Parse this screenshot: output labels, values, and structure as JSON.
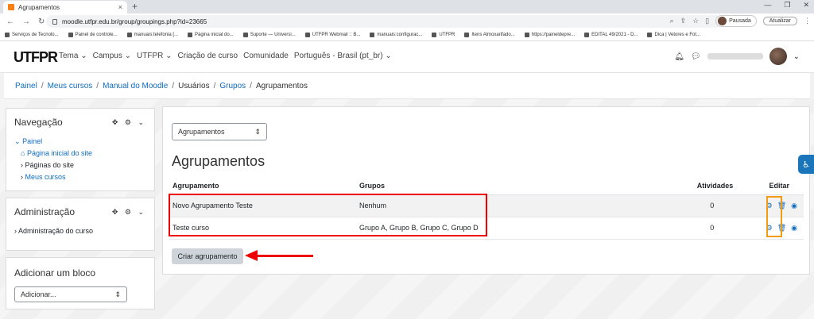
{
  "browser": {
    "tab_title": "Agrupamentos",
    "tab_close": "×",
    "new_tab": "+",
    "url": "moodle.utfpr.edu.br/group/groupings.php?id=23665",
    "profile_label": "Pausada",
    "update_label": "Atualizar",
    "bookmarks": [
      "Serviços de Tecnolo...",
      "Painel de controle...",
      "manuais:telefonia [...",
      "Página inicial do...",
      "Suporte — Universi...",
      "UTFPR Webmail :: B...",
      "manuais:configurac...",
      "UTFPR",
      "Itens Almoxarifado...",
      "https://paineldepre...",
      "EDITAL 49/2021 - D...",
      "Dica | Vetores e Fot..."
    ]
  },
  "moodle_nav": {
    "logo": "UTFPR",
    "menu": [
      "Tema ⌄",
      "Campus ⌄",
      "UTFPR ⌄",
      "Criação de curso",
      "Comunidade",
      "Português - Brasil (pt_br) ⌄"
    ]
  },
  "breadcrumb": [
    "Painel",
    "Meus cursos",
    "Manual do Moodle",
    "Usuários",
    "Grupos",
    "Agrupamentos"
  ],
  "nav_block": {
    "title": "Navegação",
    "items": [
      "Painel",
      "Página inicial do site",
      "Páginas do site",
      "Meus cursos"
    ]
  },
  "admin_block": {
    "title": "Administração",
    "items": [
      "Administração do curso"
    ]
  },
  "add_block": {
    "title": "Adicionar um bloco",
    "select_value": "Adicionar..."
  },
  "main": {
    "dropdown_value": "Agrupamentos",
    "heading": "Agrupamentos",
    "columns": [
      "Agrupamento",
      "Grupos",
      "Atividades",
      "Editar"
    ],
    "rows": [
      {
        "name": "Novo Agrupamento Teste",
        "groups": "Nenhum",
        "activities": "0"
      },
      {
        "name": "Teste curso",
        "groups": "Grupo A, Grupo B, Grupo C, Grupo D",
        "activities": "0"
      }
    ],
    "create_button": "Criar agrupamento"
  },
  "colors": {
    "link": "#0f6cbf",
    "highlight_red": "#e00000",
    "highlight_orange": "#f39c12"
  }
}
